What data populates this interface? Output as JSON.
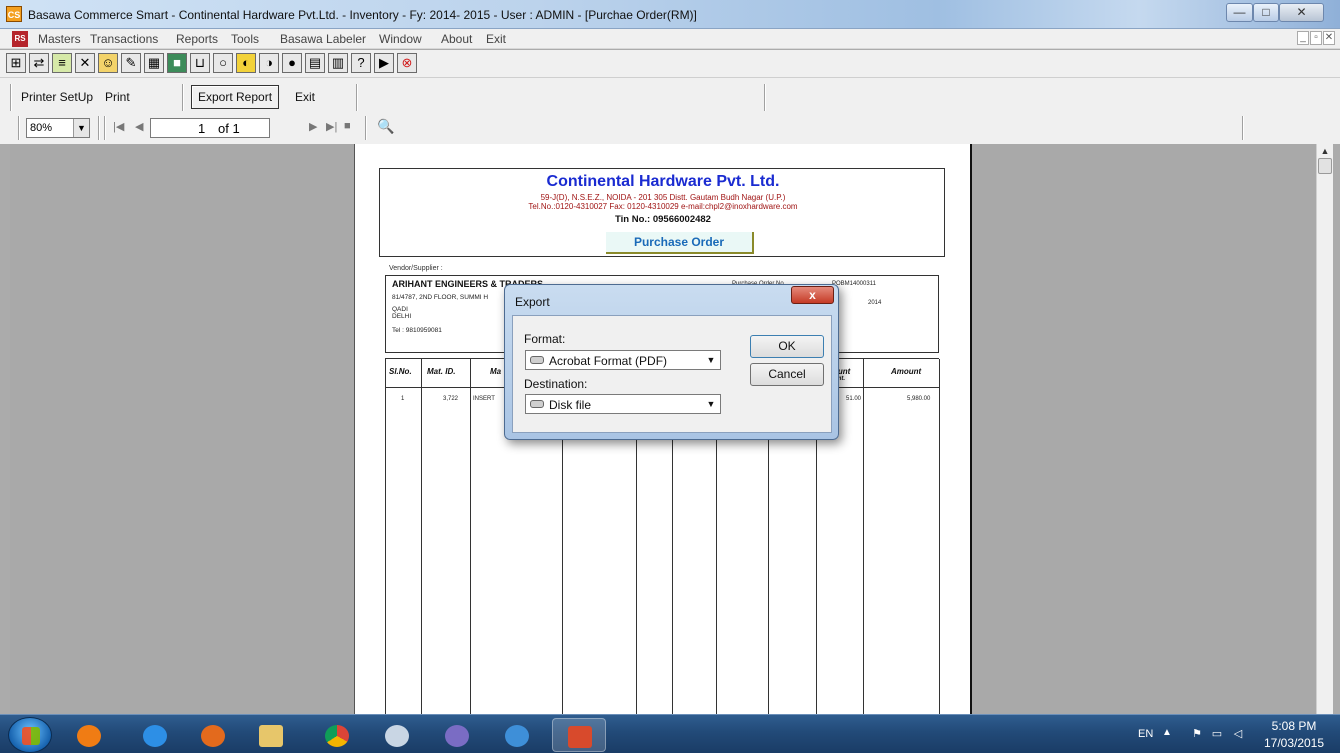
{
  "window": {
    "title": "Basawa Commerce Smart - Continental Hardware Pvt.Ltd. - Inventory  -  Fy: 2014- 2015 - User : ADMIN - [Purchae Order(RM)]",
    "app_icon": "CS",
    "min_glyph": "—",
    "max_glyph": "□",
    "close_glyph": "✕"
  },
  "menubar": {
    "icon": "RS",
    "items": [
      "Masters",
      "Transactions",
      "Reports",
      "Tools",
      "Basawa Labeler",
      "Window",
      "About",
      "Exit"
    ],
    "mdi_buttons": [
      "_",
      "▫",
      "✕"
    ]
  },
  "toolbar_icons": [
    "report-icon",
    "transfer-icon",
    "list-icon",
    "tools-icon",
    "user-icon",
    "edit-icon",
    "calculator-icon",
    "chip-icon",
    "chart-icon",
    "circle-icon",
    "halfmoon-icon",
    "full-circle-icon",
    "black-circle-icon",
    "screen-icon",
    "grid-icon",
    "help-icon",
    "flag-icon",
    "stop-icon"
  ],
  "report_toolbar": {
    "printer_setup": "Printer SetUp",
    "print": "Print",
    "export_report": "Export Report",
    "exit": "Exit",
    "zoom": "80%",
    "page_current": "1",
    "page_of": "of 1"
  },
  "report": {
    "company_name": "Continental Hardware Pvt. Ltd.",
    "address": "59-J(D), N.S.E.Z., NOIDA - 201 305 Distt. Gautam Budh Nagar (U.P.)",
    "contact": "Tel.No.:0120-4310027  Fax: 0120-4310029  e-mail:chpl2@inoxhardware.com",
    "tin": "Tin No.: 09566002482",
    "doc_title": "Purchase Order",
    "vendor_label": "Vendor/Supplier :",
    "vendor_name": "ARIHANT ENGINEERS & TRADERS",
    "vendor_address": "81/4787, 2ND FLOOR, SUMMI H",
    "vendor_city": "QADI",
    "vendor_state": "DELHI",
    "vendor_tel": "Tel :  9810959081",
    "po_no_label": "Purchase Order No.",
    "po_no_value": "POBM14000311",
    "po_date_year": "2014",
    "columns": [
      "Sl.No.",
      "Mat. ID.",
      "Ma",
      "ount",
      "mt.",
      "Amount"
    ],
    "row": {
      "sl": "1",
      "mat_id": "3,722",
      "material": "INSERT",
      "discount": "51.00",
      "amount": "5,980.00"
    }
  },
  "dialog": {
    "title": "Export",
    "close": "x",
    "format_label": "Format:",
    "format_value": "Acrobat Format (PDF)",
    "destination_label": "Destination:",
    "destination_value": "Disk file",
    "ok": "OK",
    "cancel": "Cancel"
  },
  "taskbar": {
    "apps": [
      "media-icon",
      "ie-icon",
      "firefox-icon",
      "explorer-icon",
      "chrome-icon",
      "app-icon",
      "dolphin-icon",
      "sync-icon",
      "basawa-icon"
    ],
    "lang": "EN",
    "time": "5:08 PM",
    "date": "17/03/2015"
  }
}
